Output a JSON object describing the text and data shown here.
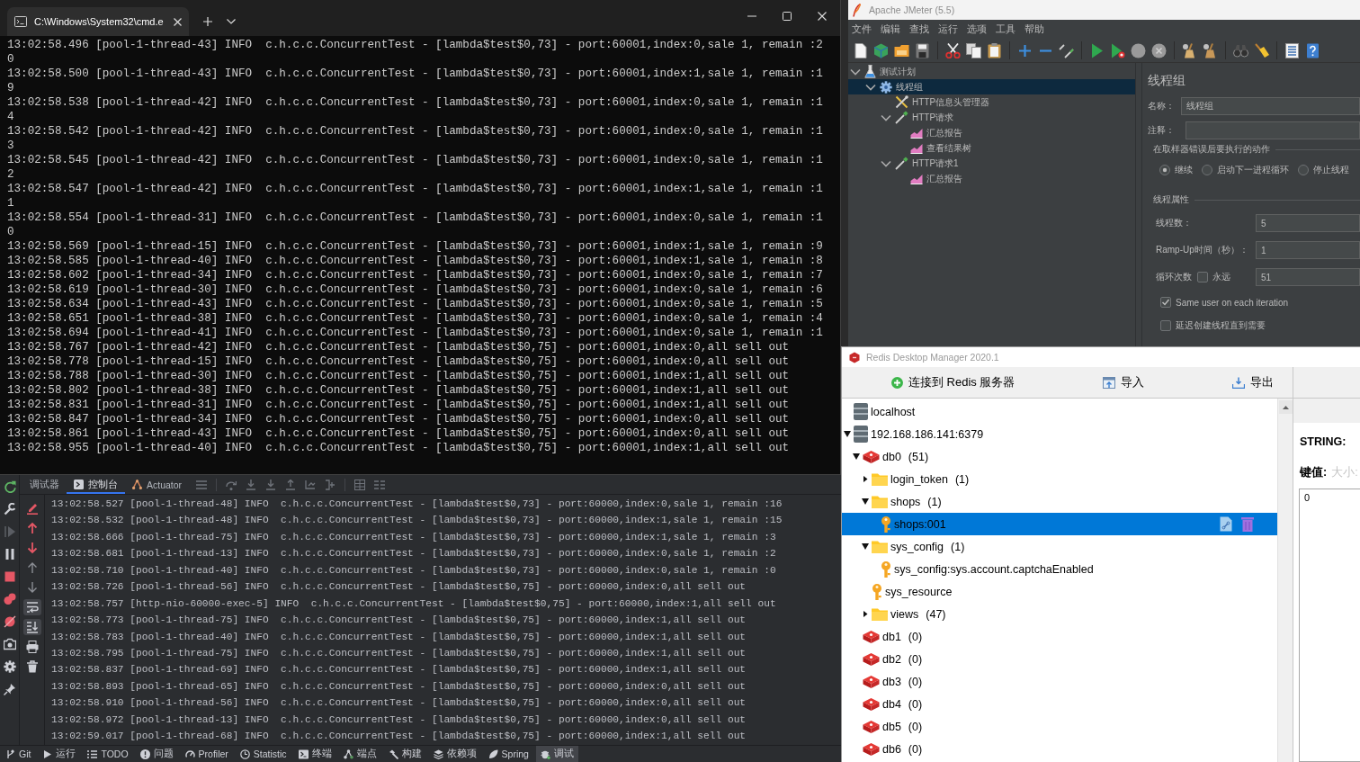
{
  "terminal": {
    "tab_title": "C:\\Windows\\System32\\cmd.e",
    "lines": [
      "13:02:58.496 [pool-1-thread-43] INFO  c.h.c.c.ConcurrentTest - [lambda$test$0,73] - port:60001,index:0,sale 1, remain :2",
      "0",
      "13:02:58.500 [pool-1-thread-43] INFO  c.h.c.c.ConcurrentTest - [lambda$test$0,73] - port:60001,index:1,sale 1, remain :1",
      "9",
      "13:02:58.538 [pool-1-thread-42] INFO  c.h.c.c.ConcurrentTest - [lambda$test$0,73] - port:60001,index:0,sale 1, remain :1",
      "4",
      "13:02:58.542 [pool-1-thread-42] INFO  c.h.c.c.ConcurrentTest - [lambda$test$0,73] - port:60001,index:0,sale 1, remain :1",
      "3",
      "13:02:58.545 [pool-1-thread-42] INFO  c.h.c.c.ConcurrentTest - [lambda$test$0,73] - port:60001,index:0,sale 1, remain :1",
      "2",
      "13:02:58.547 [pool-1-thread-42] INFO  c.h.c.c.ConcurrentTest - [lambda$test$0,73] - port:60001,index:1,sale 1, remain :1",
      "1",
      "13:02:58.554 [pool-1-thread-31] INFO  c.h.c.c.ConcurrentTest - [lambda$test$0,73] - port:60001,index:0,sale 1, remain :1",
      "0",
      "13:02:58.569 [pool-1-thread-15] INFO  c.h.c.c.ConcurrentTest - [lambda$test$0,73] - port:60001,index:1,sale 1, remain :9",
      "13:02:58.585 [pool-1-thread-40] INFO  c.h.c.c.ConcurrentTest - [lambda$test$0,73] - port:60001,index:1,sale 1, remain :8",
      "13:02:58.602 [pool-1-thread-34] INFO  c.h.c.c.ConcurrentTest - [lambda$test$0,73] - port:60001,index:0,sale 1, remain :7",
      "13:02:58.619 [pool-1-thread-30] INFO  c.h.c.c.ConcurrentTest - [lambda$test$0,73] - port:60001,index:0,sale 1, remain :6",
      "13:02:58.634 [pool-1-thread-43] INFO  c.h.c.c.ConcurrentTest - [lambda$test$0,73] - port:60001,index:0,sale 1, remain :5",
      "13:02:58.651 [pool-1-thread-38] INFO  c.h.c.c.ConcurrentTest - [lambda$test$0,73] - port:60001,index:0,sale 1, remain :4",
      "13:02:58.694 [pool-1-thread-41] INFO  c.h.c.c.ConcurrentTest - [lambda$test$0,73] - port:60001,index:0,sale 1, remain :1",
      "13:02:58.767 [pool-1-thread-42] INFO  c.h.c.c.ConcurrentTest - [lambda$test$0,75] - port:60001,index:0,all sell out",
      "13:02:58.778 [pool-1-thread-15] INFO  c.h.c.c.ConcurrentTest - [lambda$test$0,75] - port:60001,index:0,all sell out",
      "13:02:58.788 [pool-1-thread-30] INFO  c.h.c.c.ConcurrentTest - [lambda$test$0,75] - port:60001,index:1,all sell out",
      "13:02:58.802 [pool-1-thread-38] INFO  c.h.c.c.ConcurrentTest - [lambda$test$0,75] - port:60001,index:1,all sell out",
      "13:02:58.831 [pool-1-thread-31] INFO  c.h.c.c.ConcurrentTest - [lambda$test$0,75] - port:60001,index:1,all sell out",
      "13:02:58.847 [pool-1-thread-34] INFO  c.h.c.c.ConcurrentTest - [lambda$test$0,75] - port:60001,index:0,all sell out",
      "13:02:58.861 [pool-1-thread-43] INFO  c.h.c.c.ConcurrentTest - [lambda$test$0,75] - port:60001,index:0,all sell out",
      "13:02:58.955 [pool-1-thread-40] INFO  c.h.c.c.ConcurrentTest - [lambda$test$0,75] - port:60001,index:1,all sell out"
    ]
  },
  "ide": {
    "tabs": [
      {
        "kind": "debugger",
        "label": "调试器",
        "selected": false
      },
      {
        "kind": "console",
        "label": "控制台",
        "selected": true
      },
      {
        "kind": "actuator",
        "label": "Actuator",
        "selected": false
      }
    ],
    "debug_tools": [
      {
        "kind": "rerun",
        "disabled": false
      },
      {
        "kind": "wrench",
        "disabled": false
      },
      {
        "kind": "resume",
        "disabled": true
      },
      {
        "kind": "pause",
        "disabled": false
      },
      {
        "kind": "stop",
        "disabled": false
      },
      {
        "kind": "breakpoints",
        "disabled": false
      },
      {
        "kind": "mute",
        "disabled": false
      },
      {
        "kind": "camera",
        "disabled": false
      },
      {
        "kind": "gear",
        "disabled": false
      },
      {
        "kind": "pin",
        "disabled": false
      }
    ],
    "console_tools": [
      {
        "kind": "clear",
        "on": false
      },
      {
        "kind": "prev",
        "on": false
      },
      {
        "kind": "next",
        "on": false
      },
      {
        "kind": "up",
        "on": false
      },
      {
        "kind": "down",
        "on": false
      },
      {
        "kind": "wrap",
        "on": true
      },
      {
        "kind": "scroll_end",
        "on": true
      },
      {
        "kind": "print",
        "on": false
      },
      {
        "kind": "delete",
        "on": false
      }
    ],
    "console_lines": [
      "13:02:58.527 [pool-1-thread-48] INFO  c.h.c.c.ConcurrentTest - [lambda$test$0,73] - port:60000,index:0,sale 1, remain :16",
      "13:02:58.532 [pool-1-thread-48] INFO  c.h.c.c.ConcurrentTest - [lambda$test$0,73] - port:60000,index:1,sale 1, remain :15",
      "13:02:58.666 [pool-1-thread-75] INFO  c.h.c.c.ConcurrentTest - [lambda$test$0,73] - port:60000,index:1,sale 1, remain :3",
      "13:02:58.681 [pool-1-thread-13] INFO  c.h.c.c.ConcurrentTest - [lambda$test$0,73] - port:60000,index:0,sale 1, remain :2",
      "13:02:58.710 [pool-1-thread-40] INFO  c.h.c.c.ConcurrentTest - [lambda$test$0,73] - port:60000,index:0,sale 1, remain :0",
      "13:02:58.726 [pool-1-thread-56] INFO  c.h.c.c.ConcurrentTest - [lambda$test$0,75] - port:60000,index:0,all sell out",
      "13:02:58.757 [http-nio-60000-exec-5] INFO  c.h.c.c.ConcurrentTest - [lambda$test$0,75] - port:60000,index:1,all sell out",
      "13:02:58.773 [pool-1-thread-75] INFO  c.h.c.c.ConcurrentTest - [lambda$test$0,75] - port:60000,index:1,all sell out",
      "13:02:58.783 [pool-1-thread-40] INFO  c.h.c.c.ConcurrentTest - [lambda$test$0,75] - port:60000,index:1,all sell out",
      "13:02:58.795 [pool-1-thread-75] INFO  c.h.c.c.ConcurrentTest - [lambda$test$0,75] - port:60000,index:1,all sell out",
      "13:02:58.837 [pool-1-thread-69] INFO  c.h.c.c.ConcurrentTest - [lambda$test$0,75] - port:60000,index:1,all sell out",
      "13:02:58.893 [pool-1-thread-65] INFO  c.h.c.c.ConcurrentTest - [lambda$test$0,75] - port:60000,index:0,all sell out",
      "13:02:58.910 [pool-1-thread-56] INFO  c.h.c.c.ConcurrentTest - [lambda$test$0,75] - port:60000,index:0,all sell out",
      "13:02:58.972 [pool-1-thread-13] INFO  c.h.c.c.ConcurrentTest - [lambda$test$0,75] - port:60000,index:0,all sell out",
      "13:02:59.017 [pool-1-thread-68] INFO  c.h.c.c.ConcurrentTest - [lambda$test$0,75] - port:60000,index:1,all sell out"
    ],
    "status_bar": [
      {
        "kind": "git",
        "label": "Git",
        "selected": false
      },
      {
        "kind": "run",
        "label": "运行",
        "selected": false
      },
      {
        "kind": "todo",
        "label": "TODO",
        "selected": false
      },
      {
        "kind": "problems",
        "label": "问题",
        "selected": false
      },
      {
        "kind": "profiler",
        "label": "Profiler",
        "selected": false
      },
      {
        "kind": "statistic",
        "label": "Statistic",
        "selected": false
      },
      {
        "kind": "terminal",
        "label": "终端",
        "selected": false
      },
      {
        "kind": "endpoints",
        "label": "端点",
        "selected": false
      },
      {
        "kind": "build",
        "label": "构建",
        "selected": false
      },
      {
        "kind": "dependencies",
        "label": "依赖项",
        "selected": false
      },
      {
        "kind": "spring",
        "label": "Spring",
        "selected": false
      },
      {
        "kind": "debug",
        "label": "调试",
        "selected": true
      }
    ]
  },
  "jmeter": {
    "title": "Apache JMeter (5.5)",
    "menu": [
      "文件",
      "编辑",
      "查找",
      "运行",
      "选项",
      "工具",
      "帮助"
    ],
    "tree": [
      {
        "label": "测试计划",
        "kind": "test_plan",
        "expanded": true,
        "selected": false,
        "children": [
          {
            "label": "线程组",
            "kind": "thread_group",
            "expanded": true,
            "selected": true,
            "children": [
              {
                "label": "HTTP信息头管理器",
                "kind": "config",
                "selected": false
              },
              {
                "label": "HTTP请求",
                "kind": "sampler",
                "expanded": true,
                "selected": false,
                "children": [
                  {
                    "label": "汇总报告",
                    "kind": "listener",
                    "selected": false
                  },
                  {
                    "label": "查看结果树",
                    "kind": "listener",
                    "selected": false
                  }
                ]
              },
              {
                "label": "HTTP请求1",
                "kind": "sampler",
                "expanded": true,
                "selected": false,
                "children": [
                  {
                    "label": "汇总报告",
                    "kind": "listener",
                    "selected": false
                  }
                ]
              }
            ]
          }
        ]
      }
    ],
    "panel": {
      "heading": "线程组",
      "name_label": "名称：",
      "name_value": "线程组",
      "comment_label": "注释：",
      "error_action": {
        "title": "在取样器错误后要执行的动作",
        "options": [
          {
            "label": "继续",
            "selected": true
          },
          {
            "label": "启动下一进程循环",
            "selected": false
          },
          {
            "label": "停止线程",
            "selected": false
          }
        ]
      },
      "thread_properties": {
        "title": "线程属性",
        "threads_label": "线程数：",
        "threads_value": "5",
        "rampup_label": "Ramp-Up时间（秒）：",
        "rampup_value": "1",
        "loops_label": "循环次数",
        "forever_label": "永远",
        "forever_checked": false,
        "loops_value": "51"
      },
      "options": [
        {
          "label": "Same user on each iteration",
          "checked": true
        },
        {
          "label": "延迟创建线程直到需要",
          "checked": false
        }
      ]
    }
  },
  "redis": {
    "title": "Redis Desktop Manager 2020.1",
    "toolbar": [
      {
        "kind": "connect",
        "label": "连接到 Redis 服务器"
      },
      {
        "kind": "import",
        "label": "导入"
      },
      {
        "kind": "export",
        "label": "导出"
      }
    ],
    "tree": [
      {
        "label": "localhost",
        "kind": "server",
        "selected": false
      },
      {
        "label": "192.168.186.141:6379",
        "kind": "server",
        "expanded": true,
        "selected": false,
        "children": [
          {
            "label": "db0",
            "count": "(51)",
            "kind": "database",
            "expanded": true,
            "selected": false,
            "children": [
              {
                "label": "login_token",
                "count": "(1)",
                "kind": "namespace",
                "expanded": false,
                "selected": false
              },
              {
                "label": "shops",
                "count": "(1)",
                "kind": "namespace",
                "expanded": true,
                "selected": false,
                "children": [
                  {
                    "label": "shops:001",
                    "kind": "key",
                    "selected": true
                  }
                ]
              },
              {
                "label": "sys_config",
                "count": "(1)",
                "kind": "namespace",
                "expanded": true,
                "selected": false,
                "children": [
                  {
                    "label": "sys_config:sys.account.captchaEnabled",
                    "kind": "key",
                    "selected": false
                  }
                ]
              },
              {
                "label": "sys_resource",
                "kind": "key",
                "selected": false
              },
              {
                "label": "views",
                "count": "(47)",
                "kind": "namespace",
                "expanded": false,
                "selected": false
              }
            ]
          },
          {
            "label": "db1",
            "count": "(0)",
            "kind": "database",
            "selected": false
          },
          {
            "label": "db2",
            "count": "(0)",
            "kind": "database",
            "selected": false
          },
          {
            "label": "db3",
            "count": "(0)",
            "kind": "database",
            "selected": false
          },
          {
            "label": "db4",
            "count": "(0)",
            "kind": "database",
            "selected": false
          },
          {
            "label": "db5",
            "count": "(0)",
            "kind": "database",
            "selected": false
          },
          {
            "label": "db6",
            "count": "(0)",
            "kind": "database",
            "selected": false
          }
        ]
      }
    ],
    "value_panel": {
      "type_label": "STRING:",
      "key_label": "键值:",
      "size_label": "大小:",
      "value": "0"
    }
  }
}
